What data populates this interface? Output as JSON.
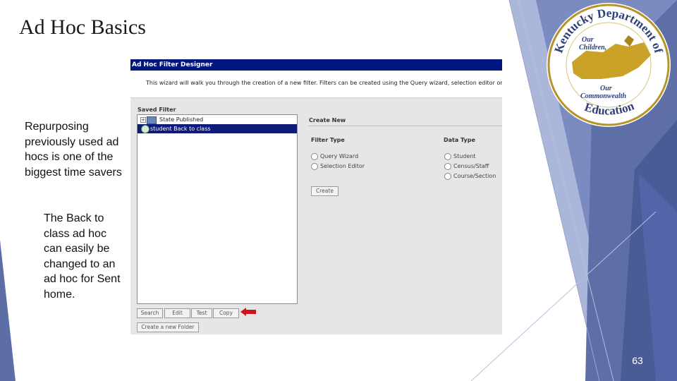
{
  "slide": {
    "title": "Ad Hoc Basics",
    "paragraph_1": "Repurposing previously used ad hocs is one of the biggest time savers",
    "paragraph_2": "The Back to class ad hoc can easily be changed to an ad hoc for Sent home.",
    "page_number": "63"
  },
  "seal": {
    "arc_text": "Kentucky Department of",
    "tagline_1": "Our",
    "tagline_2": "Children,",
    "tagline_3": "Our",
    "tagline_4": "Commonwealth",
    "bottom_text": "Education"
  },
  "screen": {
    "header": "Ad Hoc Filter Designer",
    "intro": "This wizard will walk you through the creation of a new filter. Filters can be created using the Query wizard, selection editor or a pass through SQ",
    "saved_filter_label": "Saved Filter",
    "tree": {
      "rows": [
        {
          "label": "State Published",
          "expander": "+",
          "selected": false
        },
        {
          "label": "student Back to class",
          "selected": true
        }
      ]
    },
    "buttons": {
      "search": "Search",
      "edit": "Edit",
      "test": "Test",
      "copy": "Copy",
      "create_folder": "Create a new Folder",
      "create": "Create"
    },
    "create_new": {
      "label": "Create New",
      "filter_type_label": "Filter Type",
      "data_type_label": "Data Type",
      "filter_types": [
        "Query Wizard",
        "Selection Editor"
      ],
      "data_types": [
        "Student",
        "Census/Staff",
        "Course/Section"
      ]
    }
  },
  "colors": {
    "header_blue": "#00167f",
    "selection_blue": "#0e1b7a",
    "decor_blue": "#3b4f8c",
    "seal_gold": "#c9a227",
    "arrow_red": "#d0141c"
  }
}
